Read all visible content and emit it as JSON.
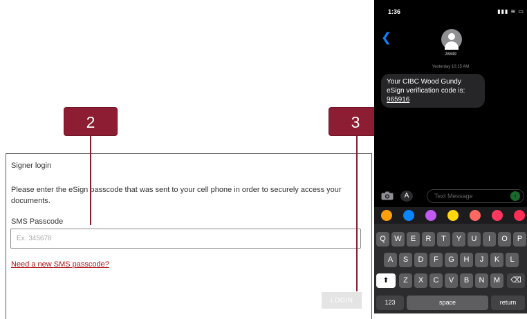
{
  "login": {
    "title": "Signer login",
    "instructions": "Please enter the eSign passcode that was sent to your cell phone in order to securely access your documents.",
    "field_label": "SMS Passcode",
    "placeholder": "Ex. 345678",
    "new_passcode_link": "Need a new SMS passcode?",
    "login_button": "LOGIN"
  },
  "callouts": [
    {
      "label": "2"
    },
    {
      "label": "3"
    }
  ],
  "phone": {
    "time": "1:36",
    "status_icons": "▮▮▮ ≋ ▭",
    "back_icon": "chevron-left-icon",
    "contact": "28849",
    "timestamp": "Yesterday 10:15 AM",
    "message_prefix": "Your CIBC Wood Gundy eSign verification code is: ",
    "message_code": "965916",
    "composer_placeholder": "Text Message",
    "app_colors": [
      "#ff9f0a",
      "#0a84ff",
      "#bf5af2",
      "#ffd60a",
      "#ff6961",
      "#ff375f",
      "#ff2d55"
    ],
    "keyboard": {
      "row1": [
        "Q",
        "W",
        "E",
        "R",
        "T",
        "Y",
        "U",
        "I",
        "O",
        "P"
      ],
      "row2": [
        "A",
        "S",
        "D",
        "F",
        "G",
        "H",
        "J",
        "K",
        "L"
      ],
      "row3": [
        "Z",
        "X",
        "C",
        "V",
        "B",
        "N",
        "M"
      ],
      "numbers": "123",
      "space": "space",
      "return": "return"
    }
  }
}
